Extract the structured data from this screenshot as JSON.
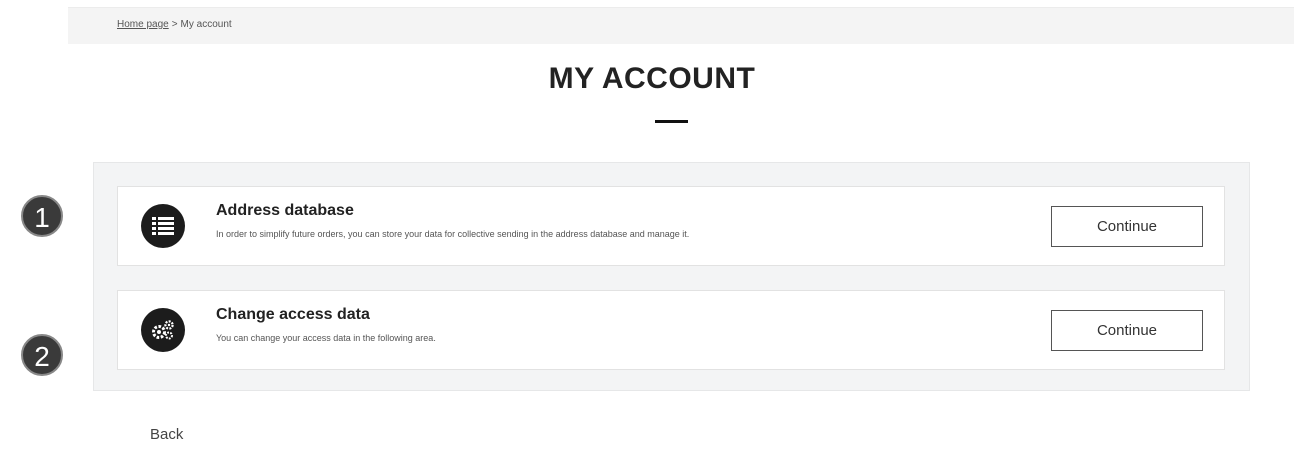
{
  "breadcrumb": {
    "home": "Home page",
    "separator": ">",
    "current": "My account"
  },
  "page": {
    "title": "MY ACCOUNT"
  },
  "steps": [
    "1",
    "2"
  ],
  "cards": [
    {
      "icon": "list-icon",
      "title": "Address database",
      "description": "In order to simplify future orders, you can store your data for collective sending in the address database and manage it.",
      "button": "Continue"
    },
    {
      "icon": "gears-icon",
      "title": "Change access data",
      "description": "You can change your access data in the following area.",
      "button": "Continue"
    }
  ],
  "footer": {
    "back": "Back"
  },
  "colors": {
    "icon_bg": "#1c1c1c",
    "panel_bg": "#f3f4f5",
    "badge_bg": "#3a3a3a"
  }
}
